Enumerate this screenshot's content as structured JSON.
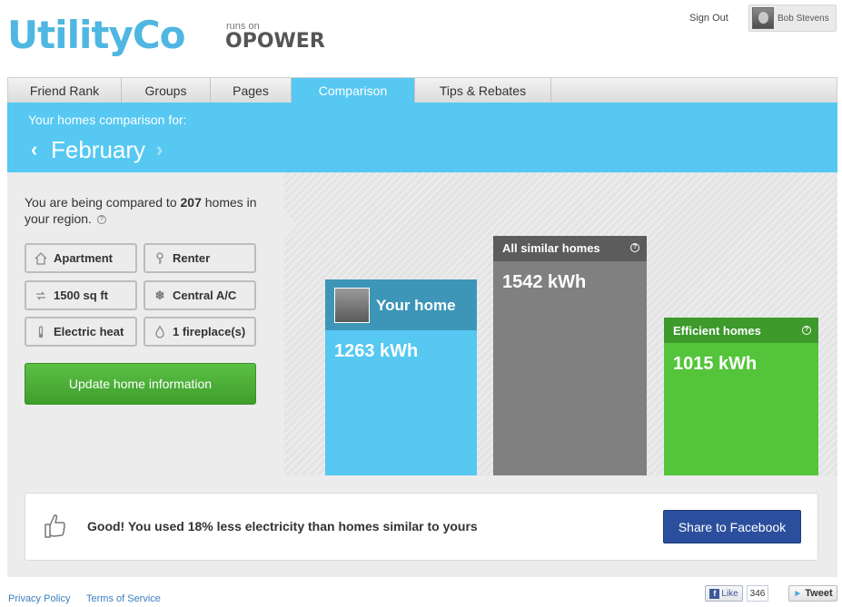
{
  "header": {
    "logo": "UtilityCo",
    "runs_on": "runs on",
    "opower": "OPOWER",
    "sign_out": "Sign Out",
    "user_name": "Bob Stevens"
  },
  "tabs": [
    {
      "label": "Friend Rank",
      "active": false
    },
    {
      "label": "Groups",
      "active": false
    },
    {
      "label": "Pages",
      "active": false
    },
    {
      "label": "Comparison",
      "active": true
    },
    {
      "label": "Tips & Rebates",
      "active": false
    }
  ],
  "period": {
    "subtitle": "Your homes comparison for:",
    "month": "February"
  },
  "comparison": {
    "prefix": "You are being compared to ",
    "count": "207",
    "suffix": " homes in your region."
  },
  "attributes": [
    {
      "label": "Apartment",
      "icon": "house-icon"
    },
    {
      "label": "Renter",
      "icon": "key-icon"
    },
    {
      "label": "1500 sq ft",
      "icon": "resize-icon"
    },
    {
      "label": "Central A/C",
      "icon": "snowflake-icon"
    },
    {
      "label": "Electric heat",
      "icon": "thermometer-icon"
    },
    {
      "label": "1 fireplace(s)",
      "icon": "flame-icon"
    }
  ],
  "update_button": "Update home information",
  "bars": [
    {
      "label": "Your home",
      "value": "1263 kWh",
      "kwh": 1263,
      "color": "#56c8f2",
      "head_color": "#3d96b8"
    },
    {
      "label": "All similar homes",
      "value": "1542 kWh",
      "kwh": 1542,
      "color": "#808080",
      "head_color": "#5c5c5c"
    },
    {
      "label": "Efficient homes",
      "value": "1015 kWh",
      "kwh": 1015,
      "color": "#54c43b",
      "head_color": "#3d9a2b"
    }
  ],
  "result": {
    "message": "Good! You used 18% less electricity than homes similar to yours",
    "share_button": "Share to Facebook"
  },
  "footer": {
    "privacy": "Privacy Policy",
    "terms": "Terms of Service",
    "like": "Like",
    "like_count": "346",
    "tweet": "Tweet"
  }
}
